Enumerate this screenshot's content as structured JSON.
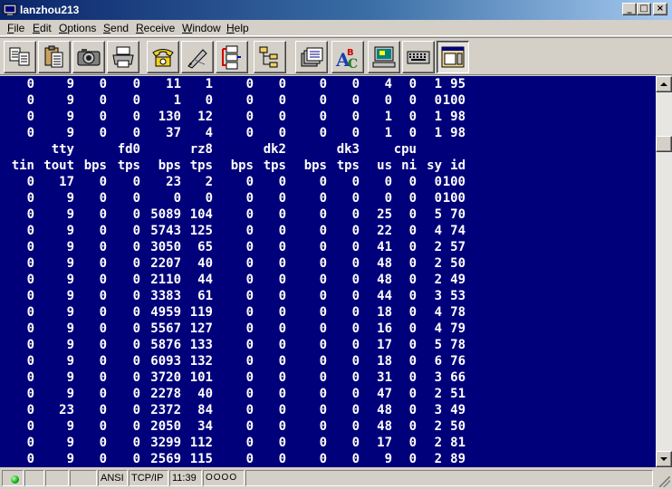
{
  "window": {
    "title": "lanzhou213"
  },
  "menu": [
    {
      "label": "File",
      "accel": "F",
      "rest": "ile"
    },
    {
      "label": "Edit",
      "accel": "E",
      "rest": "dit"
    },
    {
      "label": "Options",
      "accel": "O",
      "rest": "ptions"
    },
    {
      "label": "Send",
      "accel": "S",
      "rest": "end"
    },
    {
      "label": "Receive",
      "accel": "R",
      "rest": "eceive"
    },
    {
      "label": "Window",
      "accel": "W",
      "rest": "indow"
    },
    {
      "label": "Help",
      "accel": "H",
      "rest": "elp"
    }
  ],
  "toolbar": [
    {
      "icon": "copy-icon"
    },
    {
      "icon": "paste-icon"
    },
    {
      "icon": "camera-icon"
    },
    {
      "icon": "printer-icon"
    },
    {
      "icon": "phone-icon"
    },
    {
      "icon": "pen-icon"
    },
    {
      "icon": "network-icon"
    },
    {
      "icon": "tree-icon"
    },
    {
      "icon": "file-transfer-icon"
    },
    {
      "icon": "font-icon"
    },
    {
      "icon": "monitor-icon"
    },
    {
      "icon": "keyboard-icon"
    },
    {
      "icon": "display-settings-icon"
    }
  ],
  "terminal": {
    "lines": [
      [
        "0",
        "9",
        "0",
        "0",
        "11",
        "1",
        "0",
        "0",
        "0",
        "0",
        "4",
        "0",
        "1",
        "95"
      ],
      [
        "0",
        "9",
        "0",
        "0",
        "1",
        "0",
        "0",
        "0",
        "0",
        "0",
        "0",
        "0",
        "0",
        "100"
      ],
      [
        "0",
        "9",
        "0",
        "0",
        "130",
        "12",
        "0",
        "0",
        "0",
        "0",
        "1",
        "0",
        "1",
        "98"
      ],
      [
        "0",
        "9",
        "0",
        "0",
        "37",
        "4",
        "0",
        "0",
        "0",
        "0",
        "1",
        "0",
        "1",
        "98"
      ],
      [
        "",
        "tty",
        "",
        "fd0",
        "",
        "rz8",
        "",
        "dk2",
        "",
        "dk3",
        "",
        "cpu",
        "",
        ""
      ],
      [
        "tin",
        "tout",
        "bps",
        "tps",
        "bps",
        "tps",
        "bps",
        "tps",
        "bps",
        "tps",
        "us",
        "ni",
        "sy",
        "id"
      ],
      [
        "0",
        "17",
        "0",
        "0",
        "23",
        "2",
        "0",
        "0",
        "0",
        "0",
        "0",
        "0",
        "0",
        "100"
      ],
      [
        "0",
        "9",
        "0",
        "0",
        "0",
        "0",
        "0",
        "0",
        "0",
        "0",
        "0",
        "0",
        "0",
        "100"
      ],
      [
        "0",
        "9",
        "0",
        "0",
        "5089",
        "104",
        "0",
        "0",
        "0",
        "0",
        "25",
        "0",
        "5",
        "70"
      ],
      [
        "0",
        "9",
        "0",
        "0",
        "5743",
        "125",
        "0",
        "0",
        "0",
        "0",
        "22",
        "0",
        "4",
        "74"
      ],
      [
        "0",
        "9",
        "0",
        "0",
        "3050",
        "65",
        "0",
        "0",
        "0",
        "0",
        "41",
        "0",
        "2",
        "57"
      ],
      [
        "0",
        "9",
        "0",
        "0",
        "2207",
        "40",
        "0",
        "0",
        "0",
        "0",
        "48",
        "0",
        "2",
        "50"
      ],
      [
        "0",
        "9",
        "0",
        "0",
        "2110",
        "44",
        "0",
        "0",
        "0",
        "0",
        "48",
        "0",
        "2",
        "49"
      ],
      [
        "0",
        "9",
        "0",
        "0",
        "3383",
        "61",
        "0",
        "0",
        "0",
        "0",
        "44",
        "0",
        "3",
        "53"
      ],
      [
        "0",
        "9",
        "0",
        "0",
        "4959",
        "119",
        "0",
        "0",
        "0",
        "0",
        "18",
        "0",
        "4",
        "78"
      ],
      [
        "0",
        "9",
        "0",
        "0",
        "5567",
        "127",
        "0",
        "0",
        "0",
        "0",
        "16",
        "0",
        "4",
        "79"
      ],
      [
        "0",
        "9",
        "0",
        "0",
        "5876",
        "133",
        "0",
        "0",
        "0",
        "0",
        "17",
        "0",
        "5",
        "78"
      ],
      [
        "0",
        "9",
        "0",
        "0",
        "6093",
        "132",
        "0",
        "0",
        "0",
        "0",
        "18",
        "0",
        "6",
        "76"
      ],
      [
        "0",
        "9",
        "0",
        "0",
        "3720",
        "101",
        "0",
        "0",
        "0",
        "0",
        "31",
        "0",
        "3",
        "66"
      ],
      [
        "0",
        "9",
        "0",
        "0",
        "2278",
        "40",
        "0",
        "0",
        "0",
        "0",
        "47",
        "0",
        "2",
        "51"
      ],
      [
        "0",
        "23",
        "0",
        "0",
        "2372",
        "84",
        "0",
        "0",
        "0",
        "0",
        "48",
        "0",
        "3",
        "49"
      ],
      [
        "0",
        "9",
        "0",
        "0",
        "2050",
        "34",
        "0",
        "0",
        "0",
        "0",
        "48",
        "0",
        "2",
        "50"
      ],
      [
        "0",
        "9",
        "0",
        "0",
        "3299",
        "112",
        "0",
        "0",
        "0",
        "0",
        "17",
        "0",
        "2",
        "81"
      ],
      [
        "0",
        "9",
        "0",
        "0",
        "2569",
        "115",
        "0",
        "0",
        "0",
        "0",
        "9",
        "0",
        "2",
        "89"
      ]
    ]
  },
  "status": {
    "emulation": "ANSI",
    "protocol": "TCP/IP",
    "time": "11:39",
    "indicators": "OOOO"
  }
}
